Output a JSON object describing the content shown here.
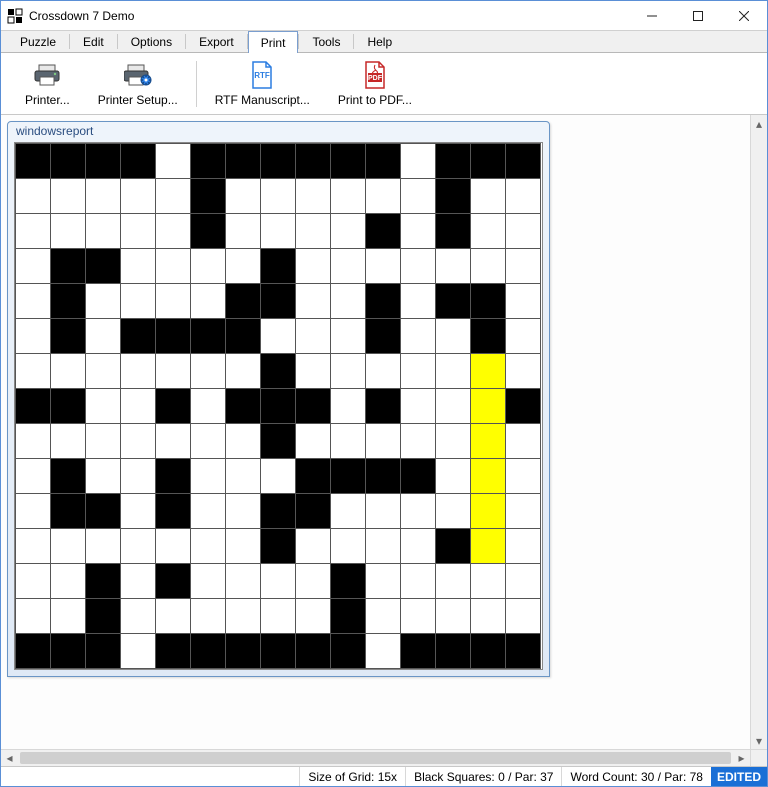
{
  "window": {
    "title": "Crossdown 7 Demo"
  },
  "menu": {
    "items": [
      "Puzzle",
      "Edit",
      "Options",
      "Export",
      "Print",
      "Tools",
      "Help"
    ],
    "selected_index": 4
  },
  "toolbar": {
    "items": [
      {
        "label": "Printer...",
        "icon": "printer-icon"
      },
      {
        "label": "Printer Setup...",
        "icon": "printer-setup-icon"
      },
      {
        "label": "RTF Manuscript...",
        "icon": "rtf-icon"
      },
      {
        "label": "Print to PDF...",
        "icon": "pdf-icon"
      }
    ],
    "separator_after_index": 1
  },
  "puzzle": {
    "title": "windowsreport",
    "grid_size": 15,
    "cells": [
      [
        1,
        1,
        1,
        1,
        0,
        1,
        1,
        1,
        1,
        1,
        1,
        0,
        1,
        1,
        1
      ],
      [
        0,
        0,
        0,
        0,
        0,
        1,
        0,
        0,
        0,
        0,
        0,
        0,
        1,
        0,
        0
      ],
      [
        0,
        0,
        0,
        0,
        0,
        1,
        0,
        0,
        0,
        0,
        1,
        0,
        1,
        0,
        0
      ],
      [
        0,
        1,
        1,
        0,
        0,
        0,
        0,
        1,
        0,
        0,
        0,
        0,
        0,
        0,
        0
      ],
      [
        0,
        1,
        0,
        0,
        0,
        0,
        1,
        1,
        0,
        0,
        1,
        0,
        1,
        1,
        0
      ],
      [
        0,
        1,
        0,
        1,
        1,
        1,
        1,
        0,
        0,
        0,
        1,
        0,
        0,
        1,
        0
      ],
      [
        0,
        0,
        0,
        0,
        0,
        0,
        0,
        1,
        0,
        0,
        0,
        0,
        0,
        2,
        0
      ],
      [
        1,
        1,
        0,
        0,
        1,
        0,
        1,
        1,
        1,
        0,
        1,
        0,
        0,
        2,
        1
      ],
      [
        0,
        0,
        0,
        0,
        0,
        0,
        0,
        1,
        0,
        0,
        0,
        0,
        0,
        2,
        0
      ],
      [
        0,
        1,
        0,
        0,
        1,
        0,
        0,
        0,
        1,
        1,
        1,
        1,
        0,
        2,
        0
      ],
      [
        0,
        1,
        1,
        0,
        1,
        0,
        0,
        1,
        1,
        0,
        0,
        0,
        0,
        2,
        0
      ],
      [
        0,
        0,
        0,
        0,
        0,
        0,
        0,
        1,
        0,
        0,
        0,
        0,
        1,
        2,
        0
      ],
      [
        0,
        0,
        1,
        0,
        1,
        0,
        0,
        0,
        0,
        1,
        0,
        0,
        0,
        0,
        0
      ],
      [
        0,
        0,
        1,
        0,
        0,
        0,
        0,
        0,
        0,
        1,
        0,
        0,
        0,
        0,
        0
      ],
      [
        1,
        1,
        1,
        0,
        1,
        1,
        1,
        1,
        1,
        1,
        0,
        1,
        1,
        1,
        1
      ]
    ]
  },
  "status": {
    "grid_size": "Size of Grid: 15x",
    "black_squares": "Black Squares: 0 / Par: 37",
    "word_count": "Word Count: 30 / Par: 78",
    "edited_flag": "EDITED"
  }
}
